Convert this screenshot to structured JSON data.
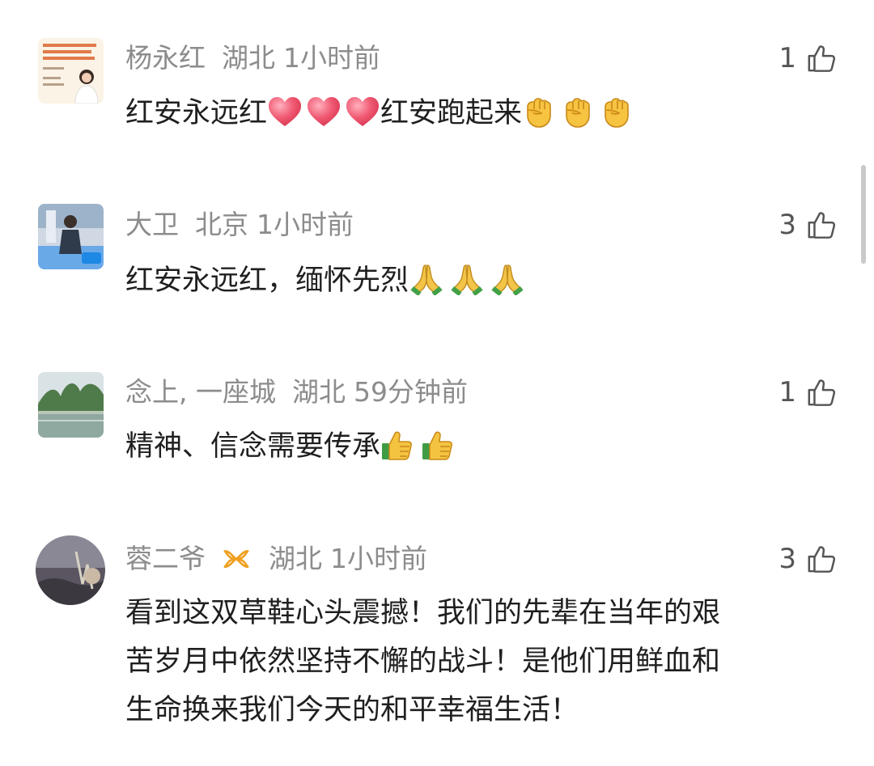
{
  "comments": [
    {
      "user": "杨永红",
      "location": "湖北",
      "time": "1小时前",
      "likes": "1",
      "text": "红安永远红",
      "text2": "红安跑起来",
      "emoji_groups": [
        "heart-emoji x3",
        "fist-emoji x3"
      ]
    },
    {
      "user": "大卫",
      "location": "北京",
      "time": "1小时前",
      "likes": "3",
      "text": "红安永远红，缅怀先烈",
      "emoji_groups": [
        "pray-emoji x3"
      ]
    },
    {
      "user": "念上, 一座城",
      "location": "湖北",
      "time": "59分钟前",
      "likes": "1",
      "text": "精神、信念需要传承",
      "emoji_groups": [
        "thumbs-up-emoji x2"
      ]
    },
    {
      "user": "蓉二爷",
      "location": "湖北",
      "time": "1小时前",
      "likes": "3",
      "lines": [
        "看到这双草鞋心头震撼！我们的先辈在当年的艰",
        "苦岁月中依然坚持不懈的战斗！是他们用鲜血和",
        "生命换来我们今天的和平幸福生活！"
      ]
    }
  ],
  "colors": {
    "meta_text": "#8c8c8c",
    "body_text": "#1f1f1f",
    "badge": "#f0a020"
  }
}
